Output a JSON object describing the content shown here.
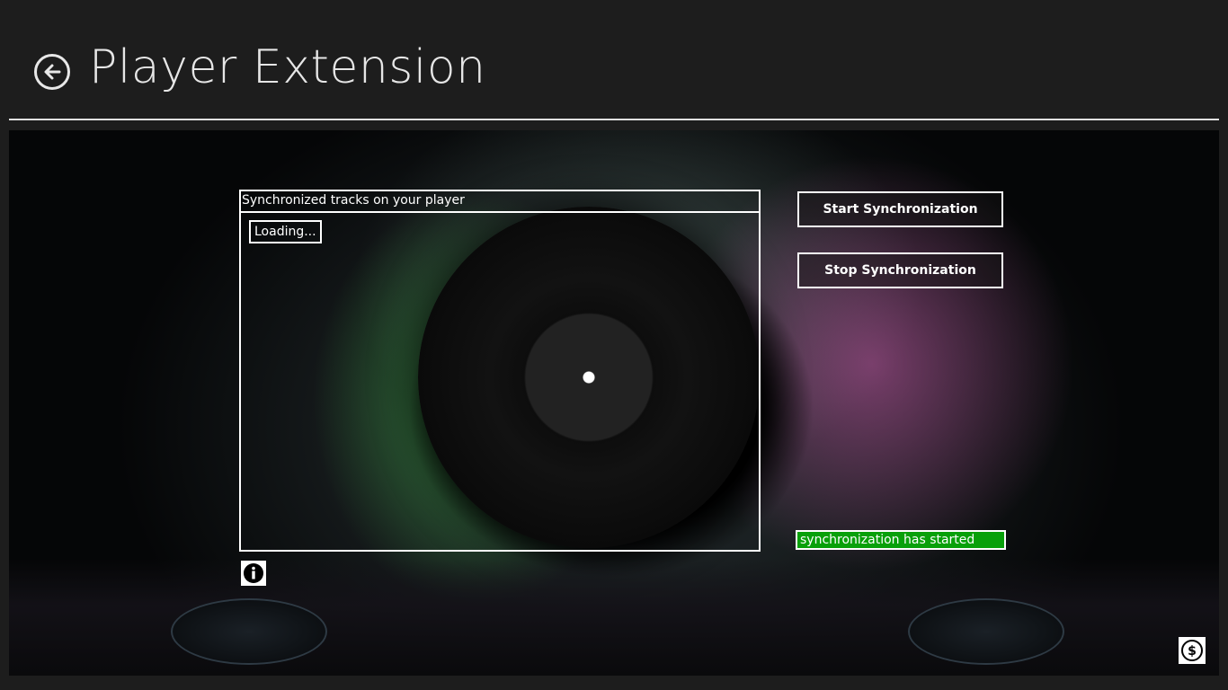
{
  "header": {
    "title": "Player Extension",
    "back_icon": "back-arrow-icon"
  },
  "tracks_panel": {
    "title": "Synchronized tracks on your player",
    "loading_text": "Loading..."
  },
  "actions": {
    "start_label": "Start Synchronization",
    "stop_label": "Stop Synchronization"
  },
  "status": {
    "text": "synchronization has started",
    "color": "#08a00a"
  },
  "icons": {
    "info": "info-icon",
    "purchase": "dollar-coin-icon"
  },
  "colors": {
    "page_background": "#1d1d1d",
    "title_text": "#e6e6e6",
    "border": "#ffffff"
  }
}
